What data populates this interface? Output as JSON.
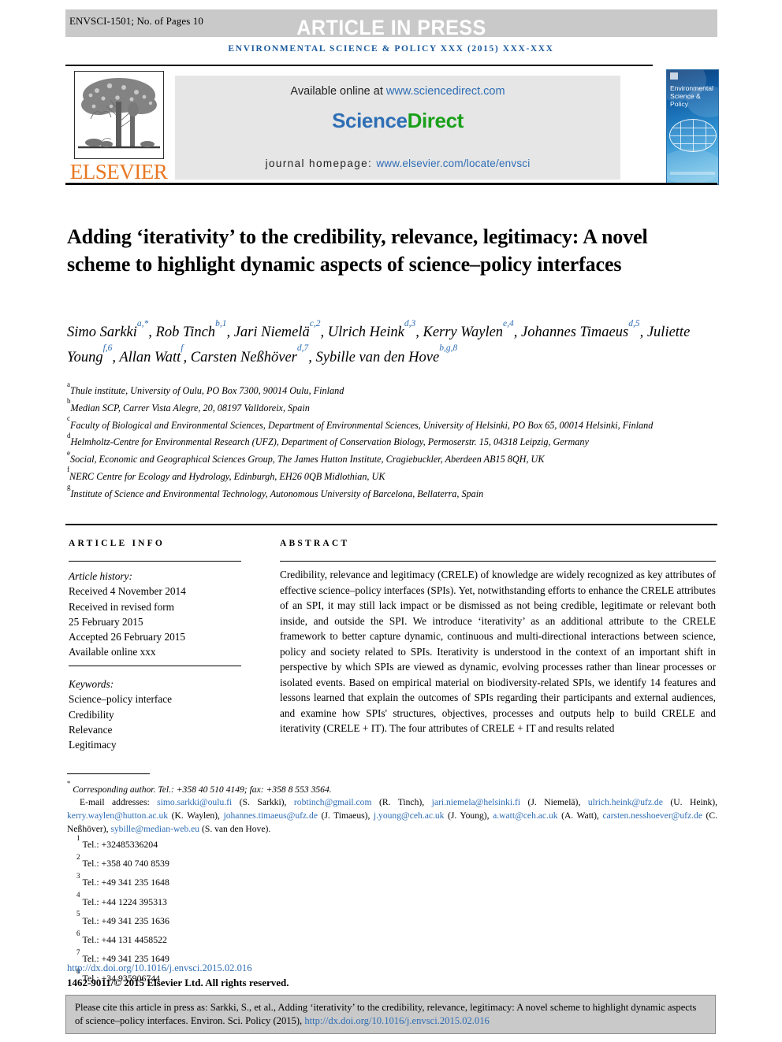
{
  "header": {
    "article_code": "ENVSCI-1501; No. of Pages 10",
    "status_banner": "ARTICLE IN PRESS",
    "journal_running_head": "ENVIRONMENTAL SCIENCE & POLICY XXX (2015) XXX-XXX"
  },
  "masthead": {
    "publisher": "ELSEVIER",
    "available_label": "Available online at ",
    "available_url": "www.sciencedirect.com",
    "sciencedirect_part1": "Science",
    "sciencedirect_part2": "Direct",
    "homepage_label": "journal homepage: ",
    "homepage_url": "www.elsevier.com/locate/envsci",
    "cover_title": "Environmental Science & Policy"
  },
  "article": {
    "title": "Adding ‘iterativity’ to the credibility, relevance, legitimacy: A novel scheme to highlight dynamic aspects of science–policy interfaces",
    "authors_line1": "Simo Sarkki",
    "authors_line1_sup": "a,*",
    "authors": [
      {
        "name": "Simo Sarkki",
        "sup": "a,*"
      },
      {
        "name": "Rob Tinch",
        "sup": "b,1"
      },
      {
        "name": "Jari Niemelä",
        "sup": "c,2"
      },
      {
        "name": "Ulrich Heink",
        "sup": "d,3"
      },
      {
        "name": "Kerry Waylen",
        "sup": "e,4"
      },
      {
        "name": "Johannes Timaeus",
        "sup": "d,5"
      },
      {
        "name": "Juliette Young",
        "sup": "f,6"
      },
      {
        "name": "Allan Watt",
        "sup": "f"
      },
      {
        "name": "Carsten Neßhöver",
        "sup": "d,7"
      },
      {
        "name": "Sybille van den Hove",
        "sup": "b,g,8"
      }
    ],
    "affiliations": [
      {
        "mark": "a",
        "text": "Thule institute, University of Oulu, PO Box 7300, 90014 Oulu, Finland"
      },
      {
        "mark": "b",
        "text": "Median SCP, Carrer Vista Alegre, 20, 08197 Valldoreix, Spain"
      },
      {
        "mark": "c",
        "text": "Faculty of Biological and Environmental Sciences, Department of Environmental Sciences, University of Helsinki, PO Box 65, 00014 Helsinki, Finland"
      },
      {
        "mark": "d",
        "text": "Helmholtz-Centre for Environmental Research (UFZ), Department of Conservation Biology, Permoserstr. 15, 04318 Leipzig, Germany"
      },
      {
        "mark": "e",
        "text": "Social, Economic and Geographical Sciences Group, The James Hutton Institute, Cragiebuckler, Aberdeen AB15 8QH, UK"
      },
      {
        "mark": "f",
        "text": "NERC Centre for Ecology and Hydrology, Edinburgh, EH26 0QB Midlothian, UK"
      },
      {
        "mark": "g",
        "text": "Institute of Science and Environmental Technology, Autonomous University of Barcelona, Bellaterra, Spain"
      }
    ]
  },
  "info": {
    "heading": "ARTICLE INFO",
    "history_label": "Article history:",
    "history": [
      "Received 4 November 2014",
      "Received in revised form",
      "25 February 2015",
      "Accepted 26 February 2015",
      "Available online xxx"
    ],
    "keywords_label": "Keywords:",
    "keywords": [
      "Science–policy interface",
      "Credibility",
      "Relevance",
      "Legitimacy"
    ]
  },
  "abstract": {
    "heading": "ABSTRACT",
    "text": "Credibility, relevance and legitimacy (CRELE) of knowledge are widely recognized as key attributes of effective science–policy interfaces (SPIs). Yet, notwithstanding efforts to enhance the CRELE attributes of an SPI, it may still lack impact or be dismissed as not being credible, legitimate or relevant both inside, and outside the SPI. We introduce ‘iterativity’ as an additional attribute to the CRELE framework to better capture dynamic, continuous and multi-directional interactions between science, policy and society related to SPIs. Iterativity is understood in the context of an important shift in perspective by which SPIs are viewed as dynamic, evolving processes rather than linear processes or isolated events. Based on empirical material on biodiversity-related SPIs, we identify 14 features and lessons learned that explain the outcomes of SPIs regarding their participants and external audiences, and examine how SPIs' structures, objectives, processes and outputs help to build CRELE and iterativity (CRELE + IT). The four attributes of CRELE + IT and results related"
  },
  "footnotes": {
    "corresponding": "Corresponding author. Tel.: +358 40 510 4149; fax: +358 8 553 3564.",
    "email_label": "E-mail addresses:",
    "emails": [
      {
        "addr": "simo.sarkki@oulu.fi",
        "who": "(S. Sarkki)"
      },
      {
        "addr": "robtinch@gmail.com",
        "who": "(R. Tinch)"
      },
      {
        "addr": "jari.niemela@helsinki.fi",
        "who": "(J. Niemelä)"
      },
      {
        "addr": "ulrich.heink@ufz.de",
        "who": "(U. Heink)"
      },
      {
        "addr": "kerry.waylen@hutton.ac.uk",
        "who": "(K. Waylen)"
      },
      {
        "addr": "johannes.timaeus@ufz.de",
        "who": "(J. Timaeus)"
      },
      {
        "addr": "j.young@ceh.ac.uk",
        "who": "(J. Young)"
      },
      {
        "addr": "a.watt@ceh.ac.uk",
        "who": "(A. Watt)"
      },
      {
        "addr": "carsten.nesshoever@ufz.de",
        "who": "(C. Neßhöver)"
      },
      {
        "addr": "sybille@median-web.eu",
        "who": "(S. van den Hove)"
      }
    ],
    "tels": [
      {
        "mark": "1",
        "text": "Tel.: +32485336204"
      },
      {
        "mark": "2",
        "text": "Tel.: +358 40 740 8539"
      },
      {
        "mark": "3",
        "text": "Tel.: +49 341 235 1648"
      },
      {
        "mark": "4",
        "text": "Tel.: +44 1224 395313"
      },
      {
        "mark": "5",
        "text": "Tel.: +49 341 235 1636"
      },
      {
        "mark": "6",
        "text": "Tel.: +44 131 4458522"
      },
      {
        "mark": "7",
        "text": "Tel.: +49 341 235 1649"
      },
      {
        "mark": "8",
        "text": "Tel.: +34 935906744"
      }
    ],
    "doi": "http://dx.doi.org/10.1016/j.envsci.2015.02.016",
    "copyright": "1462-9011/© 2015 Elsevier Ltd. All rights reserved."
  },
  "cite_box": {
    "text_before": "Please cite this article in press as: Sarkki, S., et al., Adding ‘iterativity’ to the credibility, relevance, legitimacy: A novel scheme to highlight dynamic aspects of science–policy interfaces. Environ. Sci. Policy (2015), ",
    "doi": "http://dx.doi.org/10.1016/j.envsci.2015.02.016"
  },
  "colors": {
    "banner_grey": "#c9c9c9",
    "journal_blue": "#1b5b9e",
    "link_blue": "#2e6db4",
    "elsevier_orange": "#e87722",
    "sciencedirect_green": "#1aa01a",
    "sciencedirect_blue": "#2f6fb5",
    "panel_grey": "#e6e6e6"
  }
}
